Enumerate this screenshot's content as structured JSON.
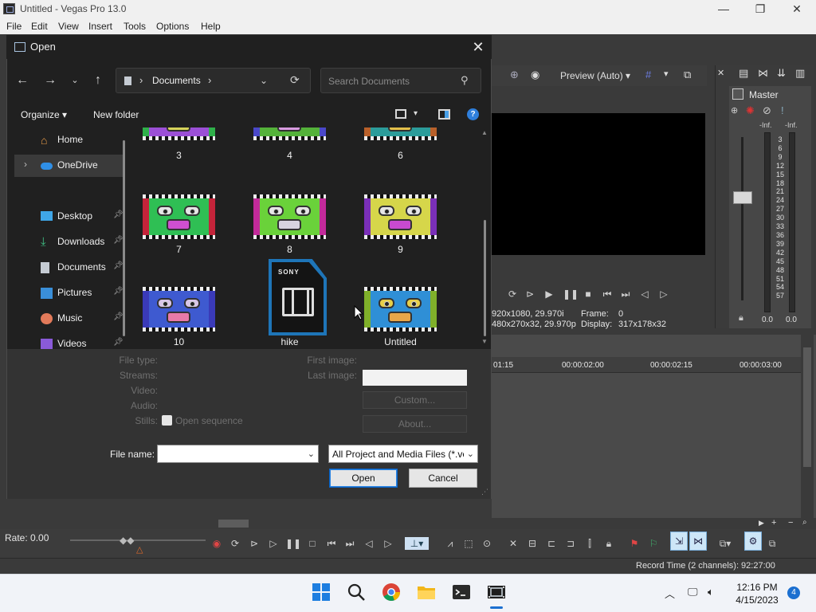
{
  "window": {
    "title": "Untitled - Vegas Pro 13.0"
  },
  "window_controls": {
    "minimize": "—",
    "maximize": "❐",
    "close": "✕"
  },
  "menu": [
    "File",
    "Edit",
    "View",
    "Insert",
    "Tools",
    "Options",
    "Help"
  ],
  "preview": {
    "mode": "Preview (Auto)",
    "project_res": "920x1080, 29.970i",
    "preview_res": "480x270x32, 29.970p",
    "frame_label": "Frame:",
    "frame_value": "0",
    "display_label": "Display:",
    "display_value": "317x178x32"
  },
  "master": {
    "label": "Master",
    "inf_left": "-Inf.",
    "inf_right": "-Inf.",
    "scale": [
      "3",
      "6",
      "9",
      "12",
      "15",
      "18",
      "21",
      "24",
      "27",
      "30",
      "33",
      "36",
      "39",
      "42",
      "45",
      "48",
      "51",
      "54",
      "57"
    ],
    "left_value": "0.0",
    "right_value": "0.0"
  },
  "timeline": {
    "ruler": [
      "01:15",
      "00:00:02:00",
      "00:00:02:15",
      "00:00:03:00"
    ]
  },
  "transport": {
    "rate": "Rate: 0.00",
    "record_time": "Record Time (2 channels): 92:27:00"
  },
  "dialog": {
    "title": "Open",
    "close": "✕",
    "breadcrumb": "Documents",
    "search_placeholder": "Search Documents",
    "organize": "Organize ▾",
    "new_folder": "New folder",
    "help": "?",
    "nav_items": [
      {
        "label": "Home",
        "pinned": false,
        "selected": false,
        "expandable": false
      },
      {
        "label": "OneDrive",
        "pinned": false,
        "selected": true,
        "expandable": true
      },
      {
        "label": "Desktop",
        "pinned": true,
        "selected": false,
        "expandable": false
      },
      {
        "label": "Downloads",
        "pinned": true,
        "selected": false,
        "expandable": false
      },
      {
        "label": "Documents",
        "pinned": true,
        "selected": false,
        "expandable": false
      },
      {
        "label": "Pictures",
        "pinned": true,
        "selected": false,
        "expandable": false
      },
      {
        "label": "Music",
        "pinned": true,
        "selected": false,
        "expandable": false
      },
      {
        "label": "Videos",
        "pinned": true,
        "selected": false,
        "expandable": false
      }
    ],
    "files": [
      "3",
      "4",
      "6",
      "7",
      "8",
      "9",
      "10",
      "hike",
      "Untitled"
    ],
    "video_badge": "SONY",
    "props": {
      "file_type": "File type:",
      "streams": "Streams:",
      "video": "Video:",
      "audio": "Audio:",
      "stills": "Stills:",
      "open_sequence": "Open sequence",
      "first_image": "First image:",
      "last_image": "Last image:",
      "custom": "Custom...",
      "about": "About..."
    },
    "file_name_label": "File name:",
    "file_name_value": "",
    "file_type_value": "All Project and Media Files (*.ve",
    "open_button": "Open",
    "cancel_button": "Cancel"
  },
  "taskbar": {
    "time": "12:16 PM",
    "date": "4/15/2023",
    "notifications": "4"
  },
  "colors": {
    "accent": "#2f7fdc",
    "dialog_bg": "#202020",
    "vegas_bg": "#3a3a3a",
    "taskbar_bg": "#f1f3f8"
  }
}
